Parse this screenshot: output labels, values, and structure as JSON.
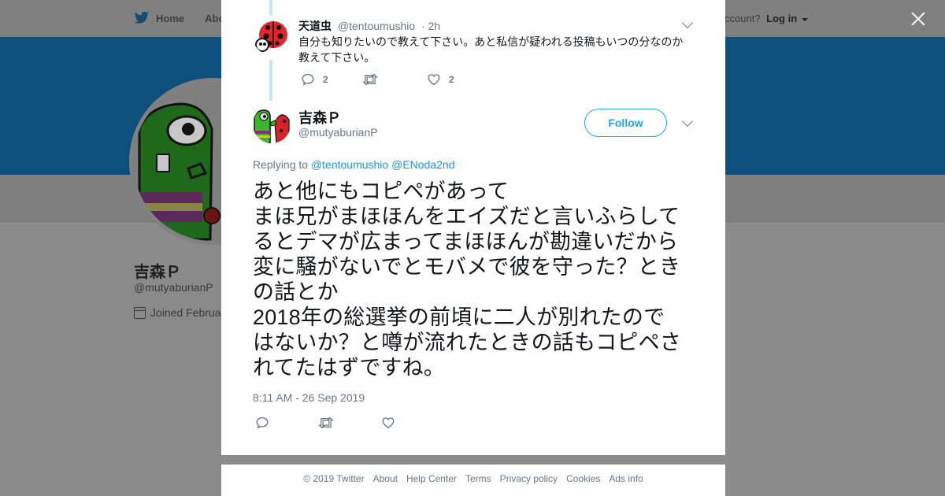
{
  "background": {
    "nav": {
      "home_label": "Home",
      "about_label": "Abo"
    },
    "account": {
      "prompt": "ccount?",
      "login_label": "Log in"
    },
    "profile": {
      "name": "吉森Ｐ",
      "handle": "@mutyaburianP",
      "joined": "Joined Februa"
    }
  },
  "modal": {
    "parent_tweet": {
      "name": "天道虫",
      "handle": "@tentoumushio",
      "time": "· 2h",
      "text": "自分も知りたいので教えて下さい。あと私信が疑われる投稿もいつの分なのか教えて下さい。",
      "reply_count": "2",
      "retweet_count": "",
      "like_count": "2"
    },
    "main_tweet": {
      "name": "吉森Ｐ",
      "handle": "@mutyaburianP",
      "follow_label": "Follow",
      "replying_prefix": "Replying to",
      "replying_to": [
        "@tentoumushio",
        "@ENoda2nd"
      ],
      "text": "あと他にもコピペがあって\nまほ兄がまほほんをエイズだと言いふらしてるとデマが広まってまほほんが勘違いだから変に騒がないでとモバメで彼を守った？ときの話とか\n2018年の総選挙の前頃に二人が別れたのではないか？と噂が流れたときの話もコピペされてたはずですね。",
      "timestamp": "8:11 AM - 26 Sep 2019"
    }
  },
  "footer": {
    "items": [
      "© 2019 Twitter",
      "About",
      "Help Center",
      "Terms",
      "Privacy policy",
      "Cookies",
      "Ads info"
    ]
  },
  "colors": {
    "accent": "#1da1f2",
    "link": "#1b95e0",
    "banner": "#0d4f7d",
    "muted": "#657786",
    "thread_line": "#c4e6f8"
  }
}
